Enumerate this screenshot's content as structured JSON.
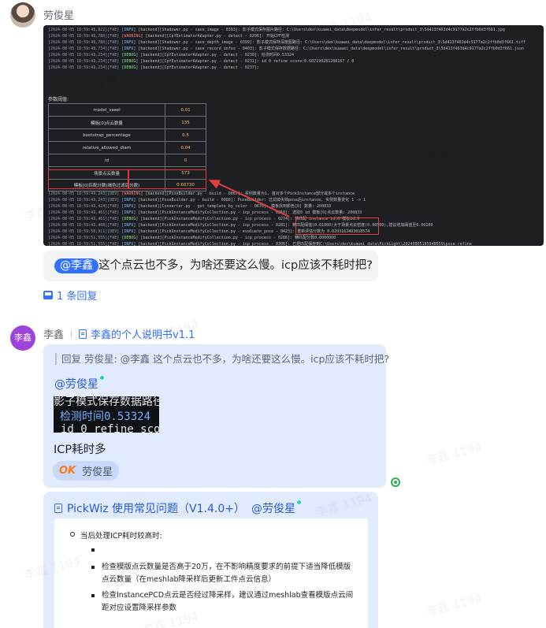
{
  "message1": {
    "sender": "劳俊星",
    "log_lines": [
      {
        "ts": "[2024-08-05 18:59:48,822]",
        "level": "FAE",
        "src": "[INFO",
        "text": "] [backend][Shadower.py - save_image - 0393]: 影子模式保存图片路径: C:\\Users\\dex\\kuawei_data\\deepmodel\\infer_result\\product_3\\5d413f463d4c9177a2c2ffb0d3f661.jpg"
      },
      {
        "ts": "[2024-08-05 18:59:48,780]",
        "level": "FAE",
        "src": "[WARNING",
        "text": "] [backend][CpfEstimatorAdapter.py - detect - 0206]: 开始CPF检测"
      },
      {
        "ts": "[2024-08-05 18:59:48,780]",
        "level": "FAE",
        "src": "[INFO",
        "text": "] [backend][Shadower.py - save_depth_image - 0399]: 影子模式保存深度图路径: C:\\Users\\dex\\kuawei_data\\deepmodel\\infer_result\\product_3\\5d413f463d4c9177a2c2ffb0d3f661.tiff"
      },
      {
        "ts": "[2024-08-05 18:59:48,734]",
        "level": "FAE",
        "src": "[INFO",
        "text": "] [backend][Shadower.py - save_record_infos - 0403]: 影子模式保存数据路径: C:\\Users\\dex\\kuawei_data\\deepmodel\\infer_result\\product_3\\5d413f463d4c9177a2c2ffb0d3f661.json"
      },
      {
        "ts": "[2024-08-05 18:59:49,234]",
        "level": "FAE",
        "src": "[DEBUG",
        "text": "] [backend][CpfEstimatorAdapter.py - detect - 0230]: 检测时间0.53324"
      },
      {
        "ts": "[2024-08-05 18:59:49,234]",
        "level": "FAE",
        "src": "[DEBUG",
        "text": "] [backend][CpfEstimatorAdapter.py - detect - 0231]: id 0 refine score:0.607190281288167 / 0"
      },
      {
        "ts": "[2024-08-05 18:59:49,234]",
        "level": "FAE",
        "src": "[DEBUG",
        "text": "] [backend][CpfEstimatorAdapter.py - detect - 0237]:"
      }
    ],
    "params_title": "参数阈值:",
    "params": [
      {
        "name": "model_voxel",
        "value": "0.01"
      },
      {
        "name": "模板[0]点云数量",
        "value": "135"
      },
      {
        "name": "bootstrap_percentage",
        "value": "0.5"
      },
      {
        "name": "relative_allowed_diam",
        "value": "0.04"
      },
      {
        "name": "id",
        "value": "0"
      },
      {
        "name": "场景点云数量",
        "value": "573"
      },
      {
        "name": "模板[0]匹配分数(褐色过滤后分数)",
        "value": "0.60730"
      }
    ],
    "log_lines2": [
      {
        "ts": "[2024-08-05 18:59:49,243]",
        "level": "DEV",
        "src": "[WARNING",
        "text": "] [backend][PoseBuilder.py - build - 0067]: 实例数量为1, 首对多个PickInstance部分或多个instance"
      },
      {
        "ts": "[2024-08-05 18:59:49,243]",
        "level": "DEV",
        "src": "[INFO",
        "text": "] [backend][PoseBuilder.py - build - 0080]: PoseBuilder: 过滤掉失效pose后instance, 实例数量变化 1 -> 1"
      },
      {
        "ts": "[2024-08-05 18:59:49,424]",
        "level": "FAE",
        "src": "[INFO",
        "text": "] [backend][Converter.py - get_template_by_color - 0670]: 模板找到颜色[0] 数量: 200833"
      },
      {
        "ts": "[2024-08-05 18:59:49,461]",
        "level": "FAE",
        "src": "[INFO",
        "text": "] [backend][PickInstanceModifyCollection.py - icp_process - 0250]: 选取0 id 模板[0]点云数量: 200833"
      },
      {
        "ts": "[2024-08-05 18:59:49,461]",
        "level": "FAE",
        "src": "[DEBUG",
        "text": "] [backend][PickInstanceModifyCollection.py - icp_process - 0274]: 精匹配 instance id:0 模板id:0"
      },
      {
        "ts": "[2024-08-05 18:59:49,408]",
        "level": "FAE",
        "src": "[INFO",
        "text": "] [backend][PickInstanceModifyCollection.py - icp_process - 0281]: 精匹配阈值(0.01000)大于场景点云密度(0.00500),建议增加阈值至0.00100"
      },
      {
        "ts": "[2024-08-05 18:59:50,911]",
        "level": "DEV",
        "src": "[INFO",
        "text": "] [backend][PickInstanceModifyCollection.py - evaluate_pose - 0423]: 重新评估分数为 0.0203162493818574"
      },
      {
        "ts": "[2024-08-05 18:59:51,555]",
        "level": "FAE",
        "src": "[DEBUG",
        "text": "] [backend][PickInstanceModifyCollection.py - icp_process - 0286]: 精匹配分数0.0000000"
      },
      {
        "ts": "[2024-08-05 18:59:51,555]",
        "level": "FAE",
        "src": "[INFO",
        "text": "] [backend][PickInstanceModifyCollection.py - icp_process - 0306]: 已把匹配保存到C:\\Users\\dex\\kuawei_data\\PickLight\\20240805185948559\\pose_refine"
      },
      {
        "ts": "[2024-08-05 18:59:54,740]",
        "level": "FAE",
        "src": "[INFO",
        "text": "] [backend][BuilderBase.py - timer_wrapper - 0079]: PoseBuilder.build 耗费时间 3.185 秒"
      },
      {
        "ts": "[2024-08-05 18:59:54,764]",
        "level": "FAE",
        "src": "[DEBUG",
        "text": "] [backend][ConfigurablePipe.py - _on_exit_node - 0017]: 节点 PoseBuilder 计算结束."
      },
      {
        "ts": "[2024-08-05 18:59:51,779]",
        "level": "DEV",
        "src": "[DEBUG",
        "text": "] [backend][ConfigurablePipe.py - _on_exit_node - 0021]: 结果状态: CODE_SUCCESS."
      },
      {
        "ts": "[2024-08-05 18:59:51,775]",
        "level": "DEV",
        "src": "[DEBUG",
        "text": "] [backend][ConfigurablePipe.py - _on_exit_node - 0022]: 节点 PoseBuilder 输出文件列表: {}."
      }
    ],
    "mention": "@李鑫",
    "text": "这个点云也不多，为啥还要这么慢。icp应该不耗时把?",
    "reply_count": "1 条回复"
  },
  "message2": {
    "avatar_text": "李鑫",
    "sender": "李鑫",
    "manual_link": "李鑫的个人说明书v1.1",
    "quote": "回复 劳俊星: @李鑫 这个点云也不多，为啥还要这么慢。icp应该不耗时把?",
    "mention": "@劳俊星",
    "code_lines": [
      "影子模式保存数据路径",
      "检测时间0.53324",
      "id 0 refine scor"
    ],
    "icp_text": "ICP耗时多",
    "reaction_emoji": "OK",
    "reaction_name": "劳俊星"
  },
  "card": {
    "title": "PickWiz 使用常见问题（V1.4.0+）",
    "mention": "@劳俊星",
    "level1": "当后处理ICP耗时较高时:",
    "bullets": [
      "",
      "检查模版点云数量是否高于20万，在不影响精度要求的前提下适当降低模版点云数量（在meshlab降采样后更新工件点云信息）",
      "检查InstancePCD点云是否经过降采样，建议通过meshlab查看模版点云间距对应设置降采样参数"
    ]
  },
  "watermark": "李鑫 1194"
}
